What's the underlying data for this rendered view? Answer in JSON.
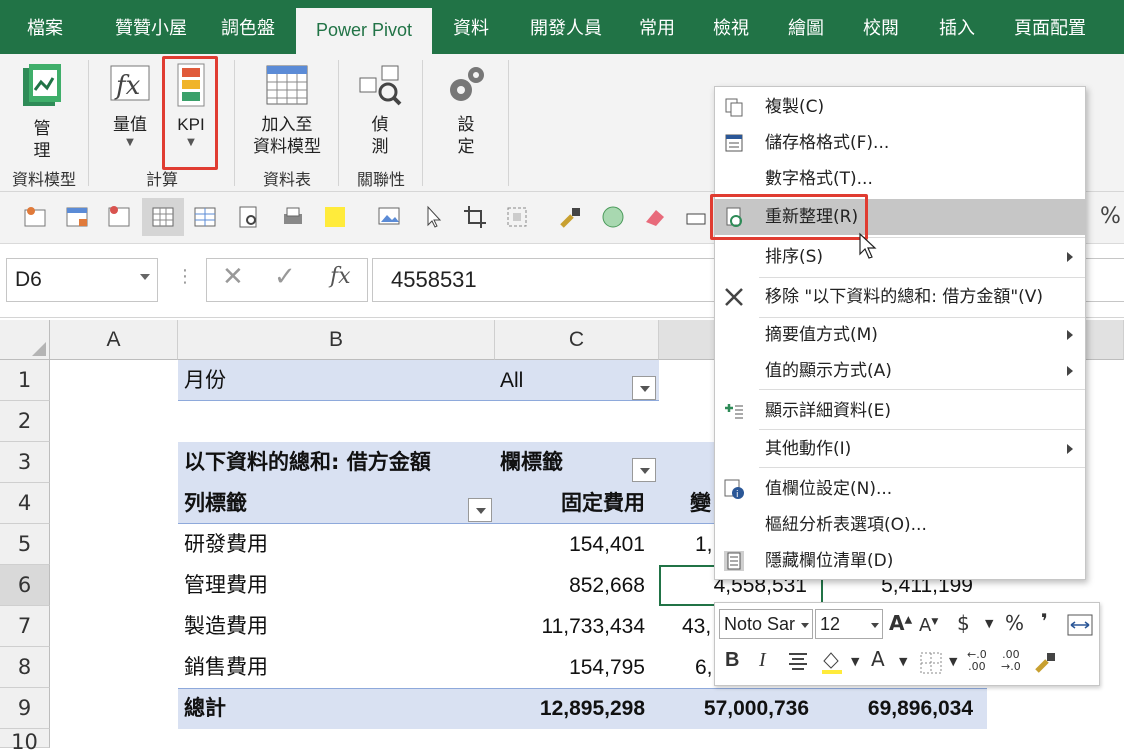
{
  "tabs": [
    "檔案",
    "贊贊小屋",
    "調色盤",
    "Power Pivot",
    "資料",
    "開發人員",
    "常用",
    "檢視",
    "繪圖",
    "校閱",
    "插入",
    "頁面配置"
  ],
  "ribbon": {
    "manage_label_1": "管",
    "manage_label_2": "理",
    "measures_label": "量值",
    "kpi_label": "KPI",
    "add_model_1": "加入至",
    "add_model_2": "資料模型",
    "detect_1": "偵",
    "detect_2": "測",
    "settings_1": "設",
    "settings_2": "定",
    "group_data_model": "資料模型",
    "group_calc": "計算",
    "group_table": "資料表",
    "group_rel": "關聯性"
  },
  "formula_bar": {
    "name_box": "D6",
    "fx": "fx",
    "value": "4558531"
  },
  "columns": [
    "A",
    "B",
    "C"
  ],
  "rows": [
    "1",
    "2",
    "3",
    "4",
    "5",
    "6",
    "7",
    "8",
    "9",
    "10"
  ],
  "pivot": {
    "filter_label": "月份",
    "filter_value": "All",
    "values_header": "以下資料的總和: 借方金額",
    "col_labels": "欄標籤",
    "row_labels": "列標籤",
    "col_fixed": "固定費用",
    "col_var_partial": "變",
    "rows": [
      {
        "label": "研發費用",
        "fixed": "154,401",
        "var": "1,"
      },
      {
        "label": "管理費用",
        "fixed": "852,668",
        "var": "4,558,531",
        "total": "5,411,199"
      },
      {
        "label": "製造費用",
        "fixed": "11,733,434",
        "var": "43,"
      },
      {
        "label": "銷售費用",
        "fixed": "154,795",
        "var": "6,"
      }
    ],
    "total": {
      "label": "總計",
      "fixed": "12,895,298",
      "var": "57,000,736",
      "grand": "69,896,034"
    }
  },
  "context_menu": {
    "items": [
      "複製(C)",
      "儲存格格式(F)...",
      "數字格式(T)...",
      "重新整理(R)",
      "排序(S)",
      "移除 \"以下資料的總和: 借方金額\"(V)",
      "摘要值方式(M)",
      "值的顯示方式(A)",
      "顯示詳細資料(E)",
      "其他動作(I)",
      "值欄位設定(N)...",
      "樞紐分析表選項(O)...",
      "隱藏欄位清單(D)"
    ]
  },
  "mini_toolbar": {
    "font": "Noto Sar",
    "size": "12",
    "bold": "B",
    "italic": "I",
    "percent": "%",
    "dollar": "$",
    "comma": "❜",
    "inc_dec": "←.0 .00",
    "dec_dec": ".00 →.0"
  },
  "qat_percent": "%",
  "colors": {
    "excel_green": "#217346",
    "header_band": "#d9e1f2",
    "highlight": "#c6c6c6",
    "red": "#e03c31"
  }
}
